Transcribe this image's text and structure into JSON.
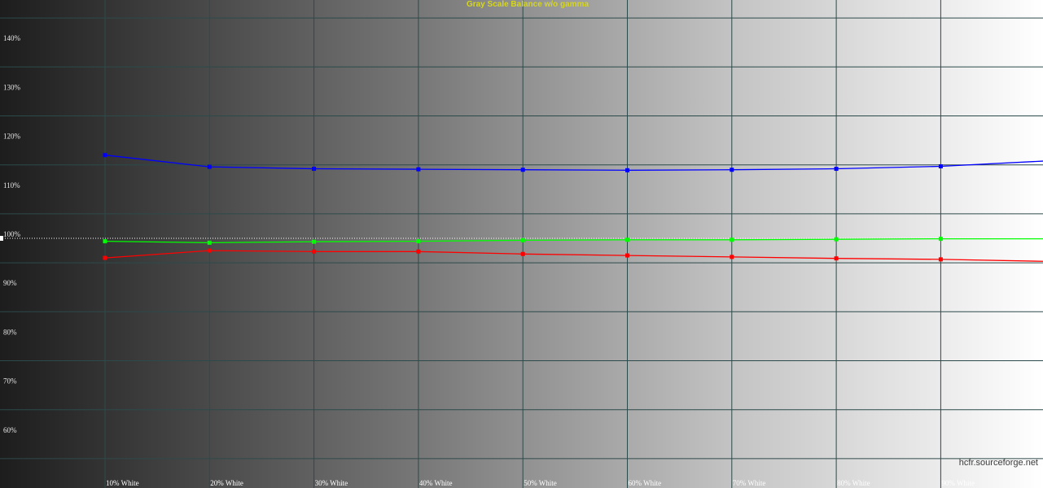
{
  "chart_data": {
    "type": "line",
    "title": "Gray Scale Balance w/o gamma",
    "watermark": "hcfr.sourceforge.net",
    "x": [
      10,
      20,
      30,
      40,
      50,
      60,
      70,
      80,
      90,
      100
    ],
    "x_tick_labels": [
      "10% White",
      "20% White",
      "30% White",
      "40% White",
      "50% White",
      "60% White",
      "70% White",
      "80% White",
      "90% White"
    ],
    "y_tick_labels": [
      "60%",
      "70%",
      "80%",
      "90%",
      "100%",
      "110%",
      "120%",
      "130%",
      "140%"
    ],
    "y_ticks": [
      60,
      70,
      80,
      90,
      100,
      110,
      120,
      130,
      140
    ],
    "ylim": [
      51,
      151
    ],
    "reference_line": 100,
    "grid": true,
    "series": [
      {
        "color": "#0000ff",
        "values": [
          117.0,
          114.6,
          114.2,
          114.1,
          114.0,
          113.9,
          114.0,
          114.2,
          114.7,
          115.8
        ]
      },
      {
        "color": "#00ff00",
        "values": [
          99.4,
          99.1,
          99.3,
          99.4,
          99.6,
          99.7,
          99.7,
          99.8,
          99.9,
          99.9
        ]
      },
      {
        "color": "#ff0000",
        "values": [
          96.0,
          97.5,
          97.3,
          97.3,
          96.8,
          96.5,
          96.2,
          95.9,
          95.7,
          95.3
        ]
      }
    ]
  }
}
